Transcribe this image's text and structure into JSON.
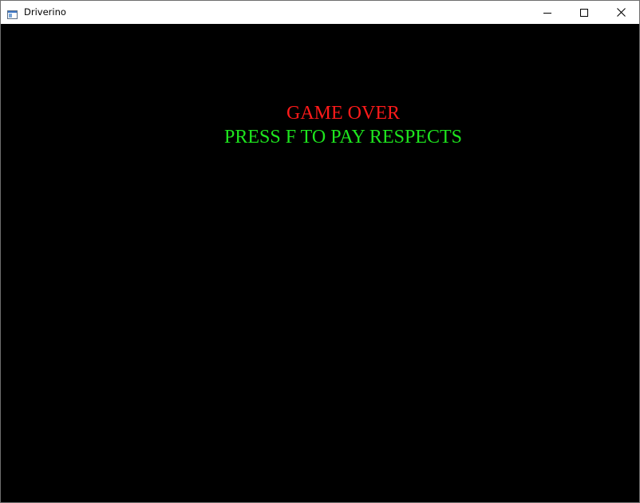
{
  "window": {
    "title": "Driverino",
    "icon": "app-window-icon",
    "controls": [
      "minimize-icon",
      "maximize-icon",
      "close-icon"
    ]
  },
  "game": {
    "background": "#000000",
    "game_over_text": "GAME OVER",
    "game_over_color": "#ff1a1a",
    "prompt_text": "PRESS F TO PAY RESPECTS",
    "prompt_color": "#1ee51e"
  }
}
